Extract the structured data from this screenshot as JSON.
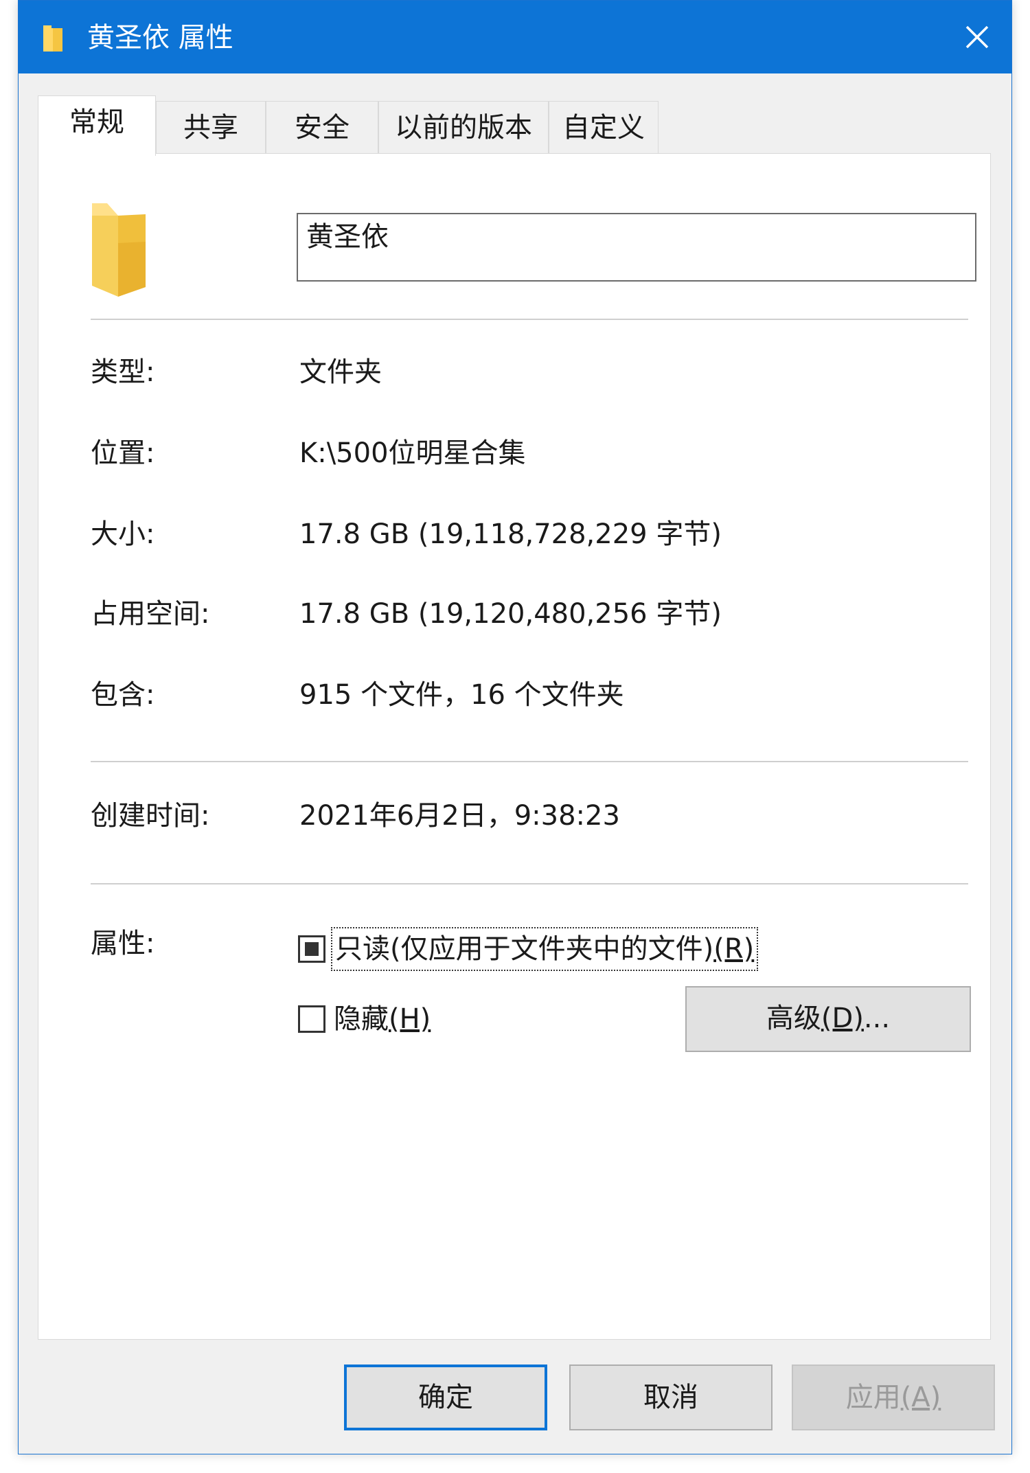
{
  "window": {
    "title": "黄圣依 属性",
    "accent_color": "#0d74d6",
    "close_icon": "close-icon",
    "title_icon": "folder-icon"
  },
  "tabs": [
    {
      "label": "常规",
      "active": true
    },
    {
      "label": "共享",
      "active": false
    },
    {
      "label": "安全",
      "active": false
    },
    {
      "label": "以前的版本",
      "active": false
    },
    {
      "label": "自定义",
      "active": false
    }
  ],
  "general": {
    "name_value": "黄圣依",
    "type_label": "类型:",
    "type_value": "文件夹",
    "location_label": "位置:",
    "location_value": "K:\\500位明星合集",
    "size_label": "大小:",
    "size_value": "17.8 GB (19,118,728,229 字节)",
    "disk_label": "占用空间:",
    "disk_value": "17.8 GB (19,120,480,256 字节)",
    "contains_label": "包含:",
    "contains_value": "915 个文件，16 个文件夹",
    "created_label": "创建时间:",
    "created_value": "2021年6月2日，9:38:23",
    "attributes_label": "属性:",
    "readonly_label": "只读(仅应用于文件夹中的文件)",
    "readonly_key": "(R)",
    "readonly_state": "indeterminate",
    "hidden_label": "隐藏",
    "hidden_key": "(H)",
    "hidden_checked": false,
    "advanced_label": "高级",
    "advanced_key": "(D)",
    "advanced_suffix": "..."
  },
  "footer": {
    "ok_label": "确定",
    "cancel_label": "取消",
    "apply_label": "应用",
    "apply_key": "(A)"
  }
}
